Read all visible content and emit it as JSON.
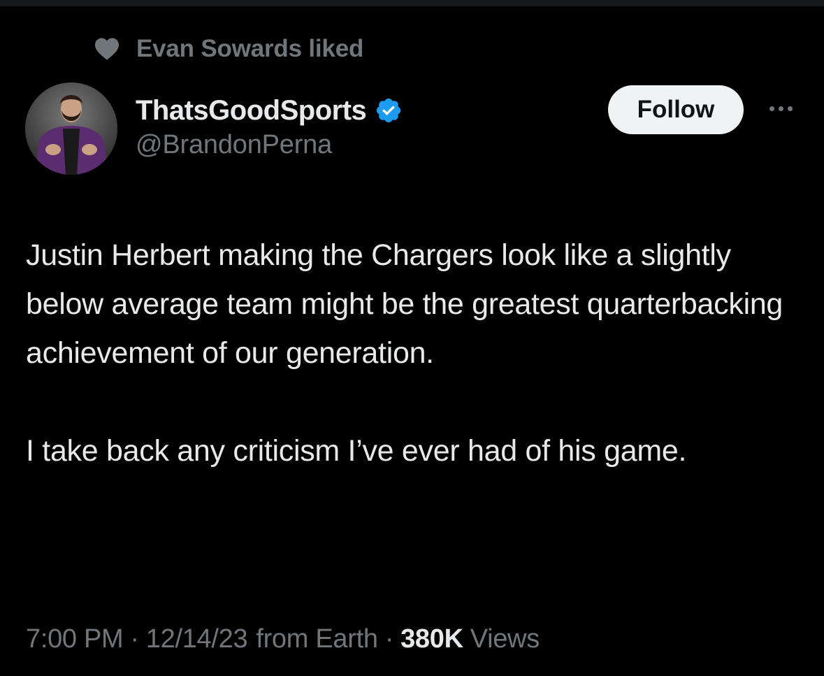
{
  "social_context": {
    "icon": "heart-icon",
    "text": "Evan Sowards liked"
  },
  "author": {
    "display_name": "ThatsGoodSports",
    "handle": "@BrandonPerna",
    "verified": true,
    "verified_icon": "verified-badge-icon"
  },
  "actions": {
    "follow_label": "Follow",
    "more_icon": "more-dots-icon"
  },
  "tweet": {
    "paragraphs": [
      "Justin Herbert making the Chargers look like a slightly below average team might be the greatest quarterbacking achievement of our generation.",
      "I take back any criticism I’ve ever had of his game."
    ]
  },
  "meta": {
    "time": "7:00 PM",
    "separator": "·",
    "date": "12/14/23",
    "source": "from Earth",
    "views_count": "380K",
    "views_label": "Views"
  },
  "colors": {
    "background": "#000000",
    "primary_text": "#e7e9ea",
    "secondary_text": "#71767b",
    "verified_blue": "#1d9bf0",
    "follow_bg": "#eff3f4"
  }
}
